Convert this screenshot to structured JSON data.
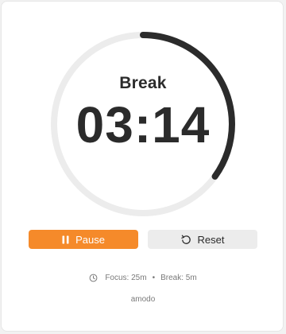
{
  "timer": {
    "phase": "Break",
    "time": "03:14",
    "progress_fraction": 0.35
  },
  "controls": {
    "pause_label": "Pause",
    "reset_label": "Reset"
  },
  "settings": {
    "focus": "Focus: 25m",
    "separator": "•",
    "break": "Break: 5m"
  },
  "brand": "amodo",
  "colors": {
    "accent": "#f58a2a",
    "ring_progress": "#2b2b2b",
    "ring_track": "#ececec",
    "text": "#2b2b2b",
    "muted": "#7a7a7a"
  },
  "icons": {
    "pause": "pause-icon",
    "reset": "reset-icon",
    "clock": "clock-icon"
  }
}
